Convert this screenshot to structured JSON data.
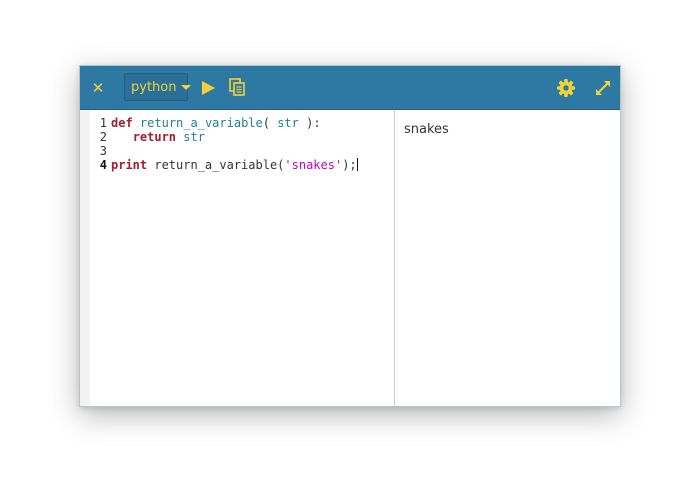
{
  "toolbar": {
    "close_icon": "close-icon",
    "language": "python",
    "run_icon": "play-icon",
    "copy_icon": "copy-icon",
    "settings_icon": "gear-icon",
    "fullscreen_icon": "expand-icon",
    "accent_color": "#f2d236",
    "background_color": "#2e79a4"
  },
  "editor": {
    "active_line": 4,
    "lines": [
      {
        "number": "1",
        "text": "def return_a_variable( str ):"
      },
      {
        "number": "2",
        "text": "   return str"
      },
      {
        "number": "3",
        "text": ""
      },
      {
        "number": "4",
        "text": "print return_a_variable('snakes');"
      }
    ],
    "tokens": {
      "line1": {
        "kw": "def",
        "fn": "return_a_variable",
        "open": "( ",
        "param": "str",
        "close": " ):"
      },
      "line2": {
        "indent": "   ",
        "kw": "return",
        "sp": " ",
        "var": "str"
      },
      "line4": {
        "kw": "print",
        "call": " return_a_variable(",
        "str": "'snakes'",
        "end": ");"
      }
    }
  },
  "output": {
    "text": "snakes"
  }
}
